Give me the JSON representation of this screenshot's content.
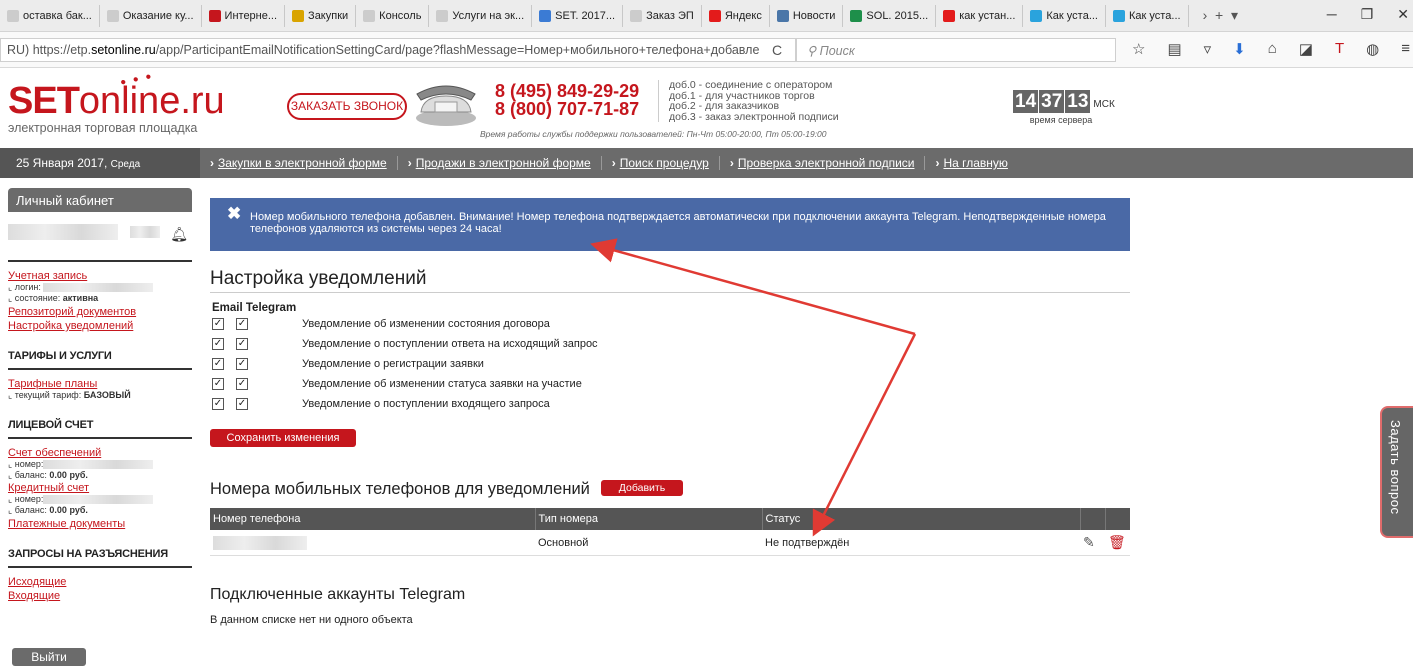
{
  "tabs": [
    {
      "label": "оставка бак...",
      "icon": "page-icon",
      "color": "#ccc"
    },
    {
      "label": "Оказание ку...",
      "icon": "page-icon",
      "color": "#ccc"
    },
    {
      "label": "Интерне...",
      "icon": "flag-icon",
      "color": "#c5161d"
    },
    {
      "label": "Закупки",
      "icon": "emblem-icon",
      "color": "#d9a400"
    },
    {
      "label": "Консоль",
      "icon": "page-icon",
      "color": "#ccc"
    },
    {
      "label": "Услуги на эк...",
      "icon": "page-icon",
      "color": "#ccc"
    },
    {
      "label": "SET. 2017...",
      "icon": "doc-icon",
      "color": "#3b7bd4"
    },
    {
      "label": "Заказ ЭП",
      "icon": "page-icon",
      "color": "#ccc"
    },
    {
      "label": "Яндекс",
      "icon": "yandex-icon",
      "color": "#e31b1b"
    },
    {
      "label": "Новости",
      "icon": "vk-icon",
      "color": "#4a76a8"
    },
    {
      "label": "SOL. 2015...",
      "icon": "sheet-icon",
      "color": "#1e8f4a"
    },
    {
      "label": "как устан...",
      "icon": "yandex-icon",
      "color": "#e31b1b"
    },
    {
      "label": "Как устa...",
      "icon": "telegram-icon",
      "color": "#2aa3dd"
    },
    {
      "label": "Как устa...",
      "icon": "telegram-icon",
      "color": "#2aa3dd"
    }
  ],
  "browser": {
    "url_prefix": "RU)  https://etp.",
    "url_domain": "setonline.ru",
    "url_path": "/app/ParticipantEmailNotificationSettingCard/page?flashMessage=Номер+мобильного+телефона+добавле",
    "search_placeholder": "Поиск"
  },
  "header": {
    "logo_set": "SET",
    "logo_online": "online",
    "logo_ru": ".ru",
    "logo_sub": "электронная торговая площадка",
    "call_button": "ЗАКАЗАТЬ ЗВОНОК",
    "phone1": "8 (495) 849-29-29",
    "phone2": "8 (800) 707-71-87",
    "hours": "Время работы службы поддержки пользователей: Пн-Чт 05:00-20:00, Пт 05:00-19:00",
    "dob0": "доб.0 - соединение с оператором",
    "dob1": "доб.1 - для участников торгов",
    "dob2": "доб.2 - для заказчиков",
    "dob3": "доб.3 - заказ электронной подписи",
    "clock_h": "14",
    "clock_m": "37",
    "clock_s": "13",
    "clock_tz": "МСК",
    "clock_caption": "время сервера"
  },
  "nav": {
    "date": "25 Января 2017,",
    "weekday": "Среда",
    "links": [
      "Закупки в электронной форме",
      "Продажи в электронной форме",
      "Поиск процедур",
      "Проверка электронной подписи",
      "На главную"
    ]
  },
  "sidebar": {
    "title": "Личный кабинет",
    "account_link": "Учетная запись",
    "login_label": "⌞ логин:",
    "state_label": "⌞ состояние:",
    "state_value": "активна",
    "repo_link": "Репозиторий документов",
    "notif_link": "Настройка уведомлений",
    "tariffs_title": "ТАРИФЫ И УСЛУГИ",
    "plans_link": "Тарифные планы",
    "tariff_label": "⌞ текущий тариф:",
    "tariff_value": "БАЗОВЫЙ",
    "account_title": "ЛИЦЕВОЙ СЧЕТ",
    "deposit_link": "Счет обеспечений",
    "number_label": "⌞ номер:",
    "balance_label": "⌞ баланс:",
    "balance_value": "0.00 руб.",
    "credit_link": "Кредитный счет",
    "number_label2": "⌞ номер:",
    "balance_label2": "⌞ баланс:",
    "balance_value2": "0.00 руб.",
    "payments_link": "Платежные документы",
    "requests_title": "ЗАПРОСЫ НА РАЗЪЯСНЕНИЯ",
    "outgoing_link": "Исходящие",
    "incoming_link": "Входящие",
    "logout": "Выйти"
  },
  "alert": {
    "text": "Номер мобильного телефона добавлен. Внимание! Номер телефона подтверждается автоматически при подключении аккаунта Telegram. Неподтвержденные номера телефонов удаляются из системы через 24 часа!"
  },
  "settings": {
    "title": "Настройка уведомлений",
    "col_email": "Email",
    "col_telegram": "Telegram",
    "rows": [
      {
        "label": "Уведомление об изменении состояния договора",
        "email": true,
        "telegram": true
      },
      {
        "label": "Уведомление о поступлении ответа на исходящий запрос",
        "email": true,
        "telegram": true
      },
      {
        "label": "Уведомление о регистрации заявки",
        "email": true,
        "telegram": true
      },
      {
        "label": "Уведомление об изменении статуса заявки на участие",
        "email": true,
        "telegram": true
      },
      {
        "label": "Уведомление о поступлении входящего запроса",
        "email": true,
        "telegram": true
      }
    ],
    "save_button": "Сохранить изменения"
  },
  "phones": {
    "title": "Номера мобильных телефонов для уведомлений",
    "add_button": "Добавить",
    "columns": [
      "Номер телефона",
      "Тип номера",
      "Статус"
    ],
    "rows": [
      {
        "type": "Основной",
        "status": "Не подтверждён"
      }
    ]
  },
  "telegram": {
    "title": "Подключенные аккаунты Telegram",
    "empty": "В данном списке нет ни одного объекта"
  },
  "side_tab": "Задать вопрос",
  "colors": {
    "brand_red": "#c5161d",
    "alert_blue": "#4a69a6",
    "annotation_red": "#e03a33"
  }
}
